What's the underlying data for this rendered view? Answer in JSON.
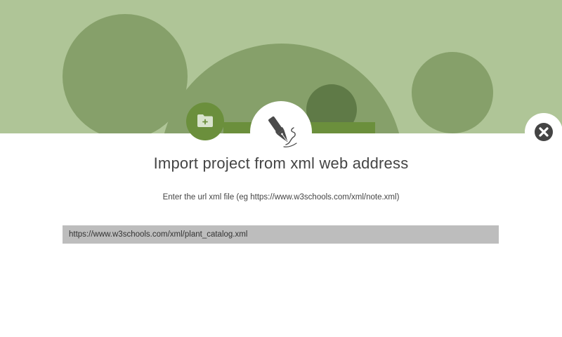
{
  "dialog": {
    "title": "Import project from xml web address",
    "hint": "Enter the url xml file (eg https://www.w3schools.com/xml/note.xml)",
    "url_value": "https://www.w3schools.com/xml/plant_catalog.xml"
  },
  "icons": {
    "folder": "folder-add-icon",
    "pen": "fountain-pen-icon",
    "close": "close-icon"
  },
  "colors": {
    "banner_light": "#afc597",
    "banner_mid": "#86a06a",
    "banner_dark": "#5f7a47",
    "accent_green": "#6b8f3c",
    "close_dark": "#444444",
    "input_bg": "#bdbdbd"
  }
}
